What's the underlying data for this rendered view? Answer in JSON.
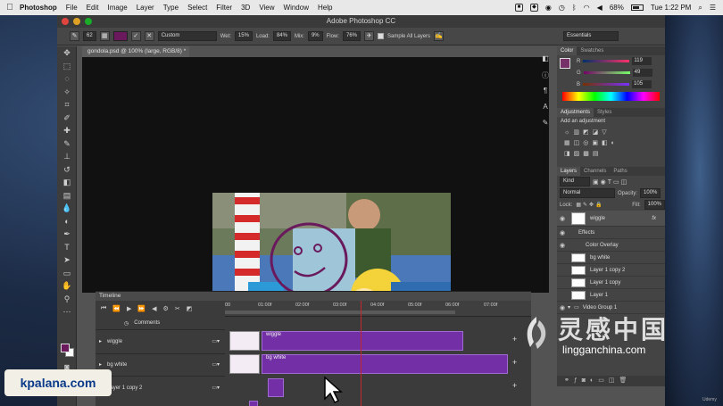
{
  "menubar": {
    "app": "Photoshop",
    "items": [
      "File",
      "Edit",
      "Image",
      "Layer",
      "Type",
      "Select",
      "Filter",
      "3D",
      "View",
      "Window",
      "Help"
    ],
    "battery": "68%",
    "time": "Tue 1:22 PM"
  },
  "window": {
    "title": "Adobe Photoshop CC"
  },
  "options": {
    "brush_size": "62",
    "mode": "Custom",
    "wet_label": "Wet:",
    "wet_value": "15%",
    "load_label": "Load:",
    "load_value": "84%",
    "mix_label": "Mix:",
    "mix_value": "9%",
    "flow_label": "Flow:",
    "flow_value": "76%",
    "sample_all_label": "Sample All Layers",
    "workspace": "Essentials",
    "paint_color": "#6a1a5c"
  },
  "document": {
    "tab": "gondola.psd @ 100% (large, RGB/8) *"
  },
  "timeline": {
    "title": "Timeline",
    "comments": "Comments",
    "ticks": [
      "00",
      "01:00f",
      "02:00f",
      "03:00f",
      "04:00f",
      "05:00f",
      "06:00f",
      "07:00f"
    ],
    "tracks": [
      {
        "name": "wiggle",
        "clip": "wiggle"
      },
      {
        "name": "bg white",
        "clip": "bg white"
      },
      {
        "name": "Layer 1 copy 2",
        "clip": ""
      }
    ]
  },
  "color_panel": {
    "tabs": [
      "Color",
      "Swatches"
    ],
    "r_label": "R",
    "r": "119",
    "g_label": "G",
    "g": "49",
    "b_label": "B",
    "b": "105",
    "color": "#773169"
  },
  "adjustments_panel": {
    "tabs": [
      "Adjustments",
      "Styles"
    ],
    "heading": "Add an adjustment"
  },
  "layers_panel": {
    "tabs": [
      "Layers",
      "Channels",
      "Paths"
    ],
    "kind": "Kind",
    "blend_mode": "Normal",
    "opacity_label": "Opacity:",
    "opacity": "100%",
    "lock_label": "Lock:",
    "fill_label": "Fill:",
    "fill": "100%",
    "layers": [
      "wiggle",
      "Effects",
      "Color Overlay",
      "bg white",
      "Layer 1 copy 2",
      "Layer 1 copy",
      "Layer 1",
      "Video Group 1"
    ]
  },
  "watermarks": {
    "left": "kpalana.com",
    "right_big": "灵感中国",
    "right_small": "lingganchina.com",
    "udemy": "Udemy"
  }
}
